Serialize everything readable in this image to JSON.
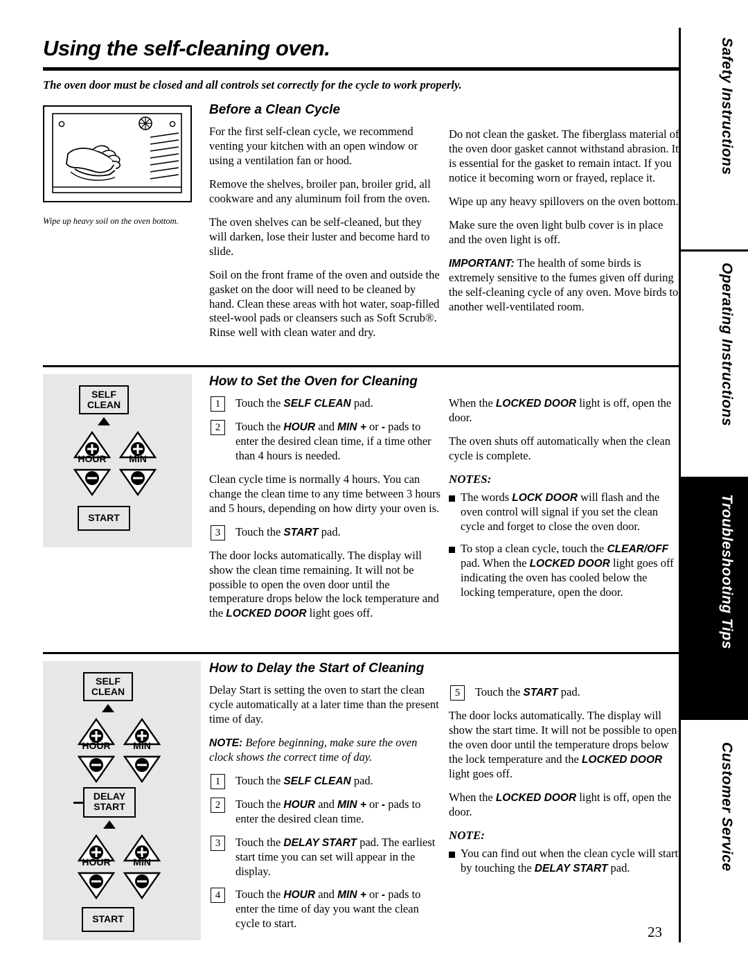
{
  "page": {
    "title": "Using the self-cleaning oven.",
    "intro": "The oven door must be closed and all controls set correctly for the cycle to work properly.",
    "number": "23"
  },
  "side_tabs": [
    {
      "label": "Safety Instructions",
      "dark": false
    },
    {
      "label": "Operating Instructions",
      "dark": false
    },
    {
      "label": "Troubleshooting Tips",
      "dark": true
    },
    {
      "label": "Customer Service",
      "dark": false
    }
  ],
  "figure_caption": "Wipe up heavy soil on the oven bottom.",
  "sections": {
    "before_clean": {
      "heading": "Before a Clean Cycle",
      "left_paragraphs": [
        "For the first self-clean cycle, we recommend venting your kitchen with an open window or using a ventilation fan or hood.",
        "Remove the shelves, broiler pan, broiler grid, all cookware and any aluminum foil from the oven.",
        "The oven shelves can be self-cleaned, but they will darken, lose their luster and become hard to slide.",
        "Soil on the front frame of the oven and outside the gasket on the door will need to be cleaned by hand. Clean these areas with hot water, soap-filled steel-wool pads or cleansers such as Soft Scrub®. Rinse well with clean water and dry."
      ],
      "right_paragraphs": [
        "Do not clean the gasket. The fiberglass material of the oven door gasket cannot withstand abrasion. It is essential for the gasket to remain intact. If you notice it becoming worn or frayed, replace it.",
        "Wipe up any heavy spillovers on the oven bottom.",
        "Make sure the oven light bulb cover is in place and the oven light is off."
      ],
      "important": {
        "label": "IMPORTANT:",
        "text": " The health of some birds is extremely sensitive to the fumes given off during the self-cleaning cycle of any oven. Move birds to another well-ventilated room."
      }
    },
    "how_to_set": {
      "heading": "How to Set the Oven for Cleaning",
      "steps": [
        {
          "num": "1",
          "pre": "Touch the ",
          "bold": "SELF CLEAN",
          "post": " pad."
        },
        {
          "num": "2",
          "pre": "Touch the ",
          "bold": "HOUR",
          "mid": " and ",
          "bold2": "MIN +",
          "mid2": " or ",
          "bold3": "-",
          "post": " pads to enter the desired clean time, if a time other than 4 hours is needed."
        },
        {
          "num": "3",
          "pre": "Touch the ",
          "bold": "START",
          "post": " pad."
        }
      ],
      "left_paragraphs": [
        "Clean cycle time is normally 4 hours. You can change the clean time to any time between 3 hours and 5 hours, depending on how dirty your oven is."
      ],
      "lock_paragraph_pre": "The door locks automatically. The display will show the clean time remaining. It will not be possible to open the oven door until the temperature drops below the lock temperature and the ",
      "lock_paragraph_bold": "LOCKED DOOR",
      "lock_paragraph_post": " light goes off.",
      "right_p1_pre": "When the ",
      "right_p1_bold": "LOCKED DOOR",
      "right_p1_post": " light is off, open the door.",
      "right_p2": "The oven shuts off automatically when the clean cycle is complete.",
      "notes_heading": "NOTES:",
      "notes": [
        {
          "pre": "The words ",
          "bold": "LOCK DOOR",
          "post": " will flash and the oven control will signal if you set the clean cycle and forget to close the oven door."
        },
        {
          "pre": "To stop a clean cycle, touch the ",
          "bold": "CLEAR/OFF",
          "mid": " pad. When the ",
          "bold2": "LOCKED DOOR",
          "post": " light goes off indicating the oven has cooled below the locking temperature, open the door."
        }
      ]
    },
    "how_to_delay": {
      "heading": "How to Delay the Start of Cleaning",
      "lead": "Delay Start is setting the oven to start the clean cycle automatically at a later time than the present time of day.",
      "note_label": "NOTE:",
      "note_text": " Before beginning, make sure the oven clock shows the correct time of day.",
      "steps": [
        {
          "num": "1",
          "pre": "Touch the ",
          "bold": "SELF CLEAN",
          "post": " pad."
        },
        {
          "num": "2",
          "pre": "Touch the ",
          "bold": "HOUR",
          "mid": " and ",
          "bold2": "MIN +",
          "mid2": " or ",
          "bold3": "-",
          "post": " pads to enter the desired clean time."
        },
        {
          "num": "3",
          "pre": "Touch the ",
          "bold": "DELAY START",
          "post": " pad. The earliest start time you can set will appear in the display."
        },
        {
          "num": "4",
          "pre": "Touch the ",
          "bold": "HOUR",
          "mid": " and ",
          "bold2": "MIN +",
          "mid2": " or ",
          "bold3": "-",
          "post": " pads to enter the time of day you want the clean cycle to start."
        },
        {
          "num": "5",
          "pre": "Touch the ",
          "bold": "START",
          "post": " pad."
        }
      ],
      "right_p1_pre": "The door locks automatically. The display will show the start time. It will not be possible to open the oven door until the temperature drops below the lock temperature and the ",
      "right_p1_bold": "LOCKED DOOR",
      "right_p1_post": " light goes off.",
      "right_p2_pre": "When the ",
      "right_p2_bold": "LOCKED DOOR",
      "right_p2_post": " light is off, open the door.",
      "note_heading": "NOTE:",
      "note_bullet": {
        "pre": "You can find out when the clean cycle will start by touching the ",
        "bold": "DELAY START",
        "post": " pad."
      }
    }
  },
  "control_panel_1": {
    "self_clean_line1": "SELF",
    "self_clean_line2": "CLEAN",
    "hour_label": "HOUR",
    "min_label": "MIN",
    "start_label": "START"
  },
  "control_panel_2": {
    "self_clean_line1": "SELF",
    "self_clean_line2": "CLEAN",
    "hour_label": "HOUR",
    "min_label": "MIN",
    "delay_line1": "DELAY",
    "delay_line2": "START",
    "hour_label2": "HOUR",
    "min_label2": "MIN",
    "start_label": "START"
  }
}
